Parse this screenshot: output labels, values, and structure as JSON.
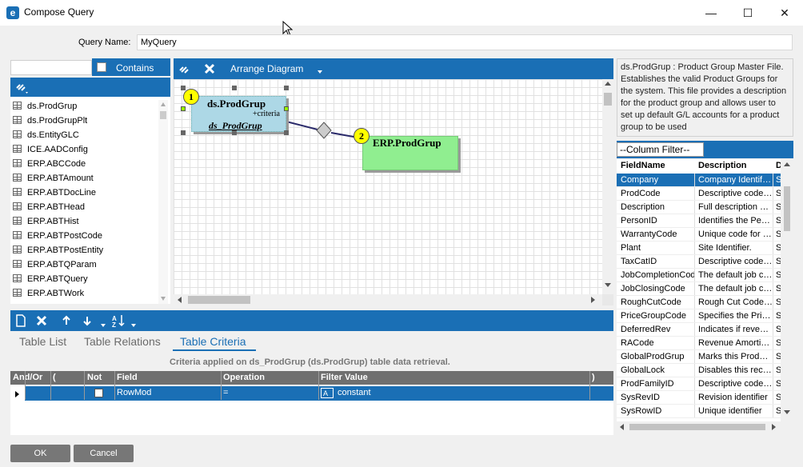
{
  "window": {
    "title": "Compose Query",
    "minimize_glyph": "—",
    "maximize_glyph": "☐",
    "close_glyph": "✕"
  },
  "query": {
    "name_label": "Query Name:",
    "name_value": "MyQuery"
  },
  "table_panel": {
    "search_value": "",
    "contains_label": "Contains",
    "items": [
      "ds.ProdGrup",
      "ds.ProdGrupPlt",
      "ds.EntityGLC",
      "ICE.AADConfig",
      "ERP.ABCCode",
      "ERP.ABTAmount",
      "ERP.ABTDocLine",
      "ERP.ABTHead",
      "ERP.ABTHist",
      "ERP.ABTPostCode",
      "ERP.ABTPostEntity",
      "ERP.ABTQParam",
      "ERP.ABTQuery",
      "ERP.ABTWork"
    ]
  },
  "diagram": {
    "arrange_label": "Arrange Diagram",
    "nodes": [
      {
        "badge": "1",
        "title": "ds.ProdGrup",
        "criteria": "+criteria",
        "alias": "ds_ProdGrup"
      },
      {
        "badge": "2",
        "title": "ERP.ProdGrup"
      }
    ]
  },
  "description": {
    "text": "ds.ProdGrup : Product Group Master File. Establishes the valid Product Groups for the system. This file provides a description for the product group and allows user to set up default G/L accounts for a product group to be used"
  },
  "column_filter": {
    "button_label": "--Column Filter--",
    "headers": [
      "FieldName",
      "Description",
      "D"
    ],
    "rows": [
      {
        "field": "Company",
        "desc": "Company Identifier.",
        "d": "S",
        "selected": true
      },
      {
        "field": "ProdCode",
        "desc": "Descriptive code assigned",
        "d": "S"
      },
      {
        "field": "Description",
        "desc": "Full description of the",
        "d": "S"
      },
      {
        "field": "PersonID",
        "desc": "Identifies the Person",
        "d": "S"
      },
      {
        "field": "WarrantyCode",
        "desc": "Unique code for the",
        "d": "S"
      },
      {
        "field": "Plant",
        "desc": "Site Identifier.",
        "d": "S"
      },
      {
        "field": "TaxCatID",
        "desc": "Descriptive code assigned",
        "d": "S"
      },
      {
        "field": "JobCompletionCode",
        "desc": "The default job completion",
        "d": "S"
      },
      {
        "field": "JobClosingCode",
        "desc": "The default job closing",
        "d": "S"
      },
      {
        "field": "RoughCutCode",
        "desc": "Rough Cut Code used",
        "d": "S"
      },
      {
        "field": "PriceGroupCode",
        "desc": "Specifies the Price Group",
        "d": "S"
      },
      {
        "field": "DeferredRev",
        "desc": "Indicates if revenue is",
        "d": "S"
      },
      {
        "field": "RACode",
        "desc": "Revenue Amortization",
        "d": "S"
      },
      {
        "field": "GlobalProdGrup",
        "desc": "Marks this ProdGrup",
        "d": "S"
      },
      {
        "field": "GlobalLock",
        "desc": "Disables this record",
        "d": "S"
      },
      {
        "field": "ProdFamilyID",
        "desc": "Descriptive code assigned",
        "d": "S"
      },
      {
        "field": "SysRevID",
        "desc": "Revision identifier",
        "d": "S"
      },
      {
        "field": "SysRowID",
        "desc": "Unique identifier",
        "d": "S"
      }
    ]
  },
  "criteria": {
    "tabs": [
      "Table List",
      "Table Relations",
      "Table Criteria"
    ],
    "active_tab": "Table Criteria",
    "caption": "Criteria applied on ds_ProdGrup (ds.ProdGrup)  table data retrieval.",
    "headers": {
      "and_or": "And/Or",
      "open_paren": "(",
      "not": "Not",
      "field": "Field",
      "operation": "Operation",
      "filter_value": "Filter Value",
      "close_paren": ")"
    },
    "row": {
      "field": "RowMod",
      "operation": "=",
      "filter_value": "constant"
    }
  },
  "footer": {
    "ok_label": "OK",
    "cancel_label": "Cancel"
  }
}
